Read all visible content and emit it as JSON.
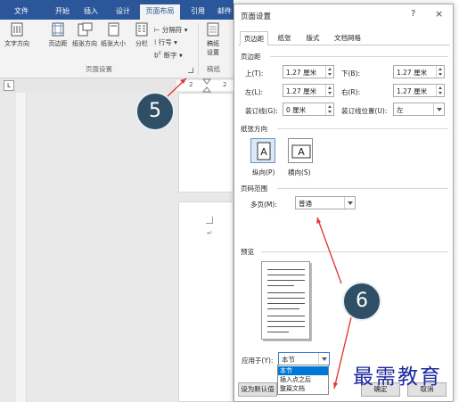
{
  "ribbon": {
    "tabs": [
      "文件",
      "开始",
      "插入",
      "设计",
      "页面布局",
      "引用",
      "邮件"
    ],
    "buttons": [
      "文字方向",
      "页边距",
      "纸张方向",
      "纸张大小",
      "分栏"
    ],
    "small": [
      "分隔符",
      "行号",
      "断字"
    ],
    "draft": [
      "稿纸",
      "设置"
    ],
    "group_page_setup": "页面设置",
    "group_draft": "稿纸"
  },
  "ruler": {
    "corner": "L",
    "numbers": [
      "2",
      "2"
    ]
  },
  "dialog": {
    "title": "页面设置",
    "help": "?",
    "close": "×",
    "tabs": [
      "页边距",
      "纸张",
      "版式",
      "文档网格"
    ],
    "margins_title": "页边距",
    "fields": {
      "top": {
        "label": "上(T):",
        "value": "1.27 厘米"
      },
      "bottom": {
        "label": "下(B):",
        "value": "1.27 厘米"
      },
      "left": {
        "label": "左(L):",
        "value": "1.27 厘米"
      },
      "right": {
        "label": "右(R):",
        "value": "1.27 厘米"
      },
      "gutter": {
        "label": "装订线(G):",
        "value": "0 厘米"
      },
      "gutter_pos": {
        "label": "装订线位置(U):",
        "value": "左"
      }
    },
    "orientation_title": "纸张方向",
    "portrait": "纵向(P)",
    "landscape": "横向(S)",
    "pages_title": "页码范围",
    "multiple_label": "多页(M):",
    "multiple_value": "普通",
    "preview_title": "预览",
    "apply_label": "应用于(Y):",
    "apply_value": "本节",
    "apply_options": [
      "本节",
      "插入点之后",
      "整篇文档"
    ],
    "default_button": "设为默认值",
    "ok_button": "确定",
    "cancel_button": "取消"
  },
  "annotations": {
    "step5": "5",
    "step6": "6",
    "watermark": "最需教育"
  },
  "colors": {
    "ribbon_blue": "#2b579a",
    "badge": "#2f4f66",
    "arrow": "#e53935",
    "watermark": "#1b2a9c"
  }
}
